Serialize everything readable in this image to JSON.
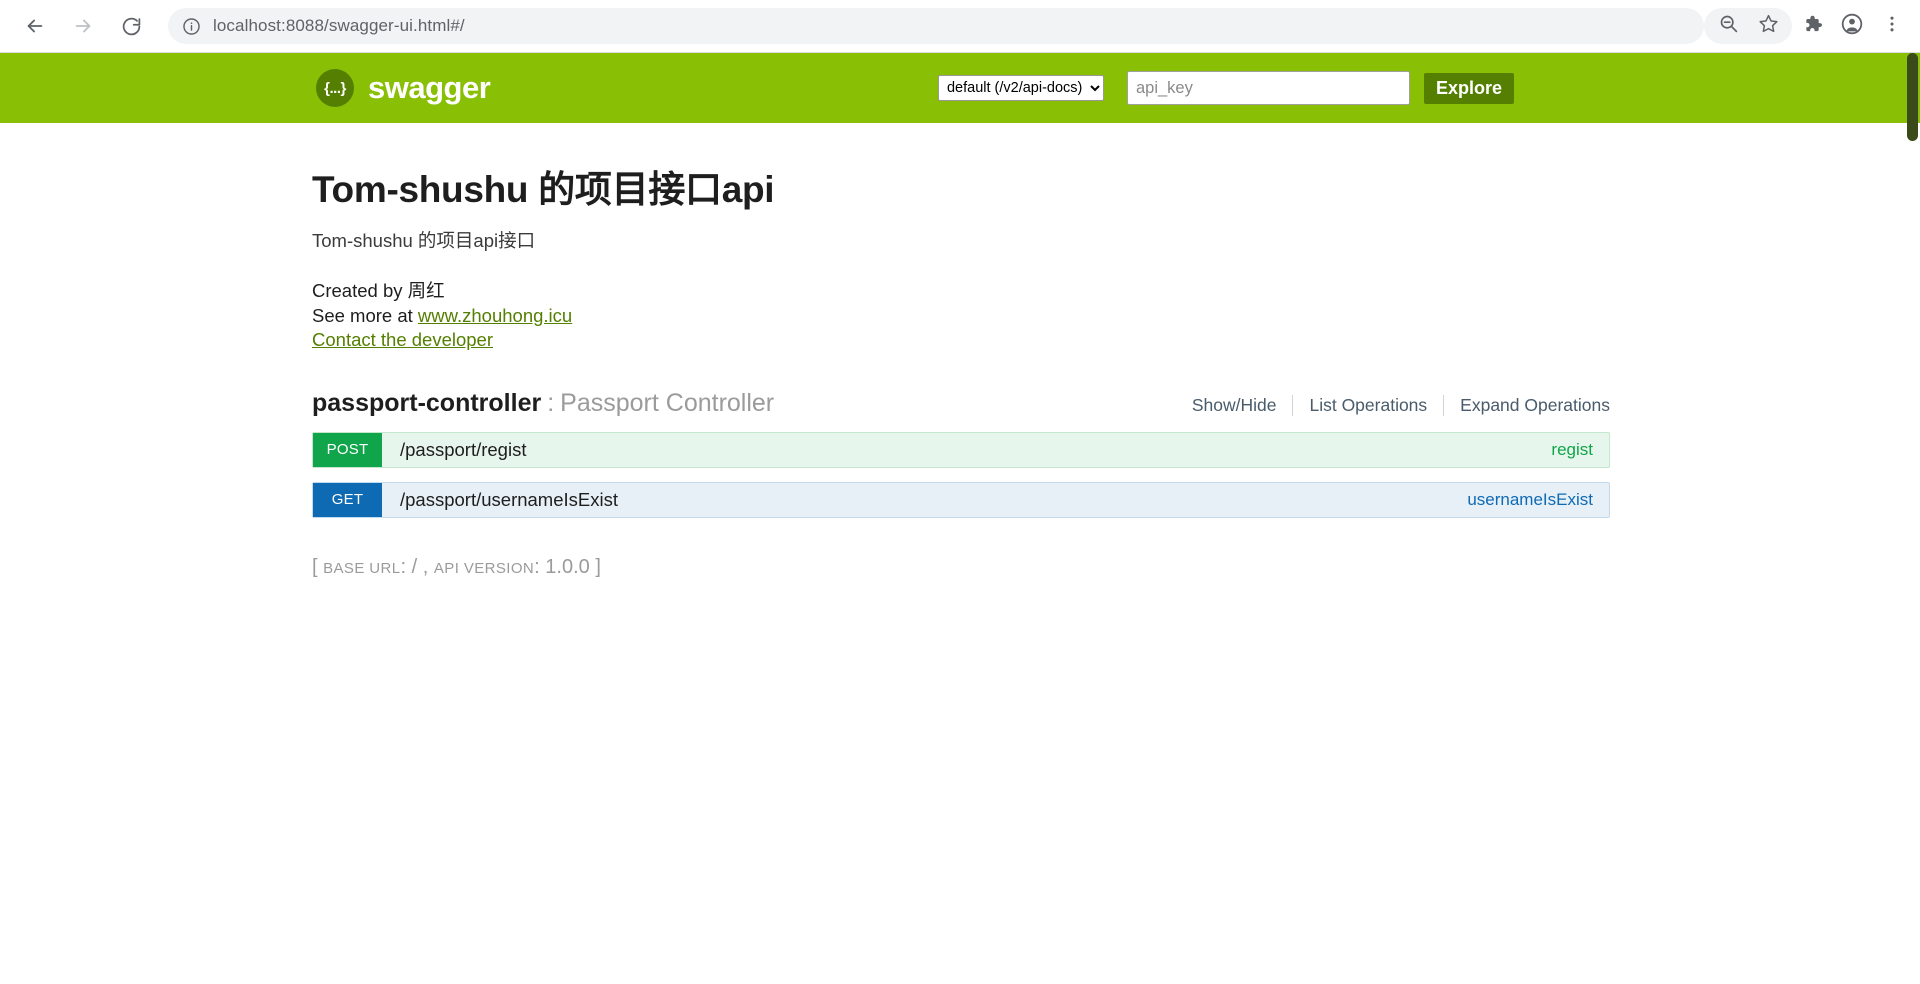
{
  "browser": {
    "nav": {
      "back_icon": "arrow-left-icon",
      "forward_icon": "arrow-right-icon",
      "reload_icon": "reload-icon"
    },
    "omnibox": {
      "site_info_icon": "info-circle-icon",
      "url_host": "localhost:8088",
      "url_path": "/swagger-ui.html#/",
      "url_full": "localhost:8088/swagger-ui.html#/"
    },
    "toolbar": {
      "zoom_out_icon": "zoom-out-icon",
      "bookmark_icon": "star-icon",
      "extensions_icon": "puzzle-piece-icon",
      "profile_icon": "account-circle-icon",
      "menu_icon": "three-dot-menu-icon"
    }
  },
  "header": {
    "logo_glyph": "{...}",
    "wordmark": "swagger",
    "spec_select": {
      "selected": "default (/v2/api-docs)",
      "options": [
        "default (/v2/api-docs)"
      ]
    },
    "api_key_placeholder": "api_key",
    "api_key_value": "",
    "explore_label": "Explore",
    "bg_color": "#89bf04",
    "accent_color": "#547f00"
  },
  "info": {
    "title": "Tom-shushu 的项目接口api",
    "description": "Tom-shushu 的项目api接口",
    "created_by_prefix": "Created by ",
    "created_by_name": "周红",
    "see_more_prefix": "See more at ",
    "see_more_link": "www.zhouhong.icu",
    "contact_link": "Contact the developer"
  },
  "resource": {
    "name": "passport-controller",
    "separator": ":",
    "description": "Passport Controller",
    "options": [
      {
        "label": "Show/Hide"
      },
      {
        "label": "List Operations"
      },
      {
        "label": "Expand Operations"
      }
    ]
  },
  "operations": [
    {
      "method": "POST",
      "path": "/passport/regist",
      "summary": "regist",
      "style": "post",
      "color": "#10a54a"
    },
    {
      "method": "GET",
      "path": "/passport/usernameIsExist",
      "summary": "usernameIsExist",
      "style": "get",
      "color": "#0f6ab4"
    }
  ],
  "footer": {
    "open_bracket": "[",
    "base_url_label": "BASE URL",
    "base_url_value": "/",
    "comma": ",",
    "api_version_label": "API VERSION",
    "api_version_value": "1.0.0",
    "close_bracket": "]"
  }
}
